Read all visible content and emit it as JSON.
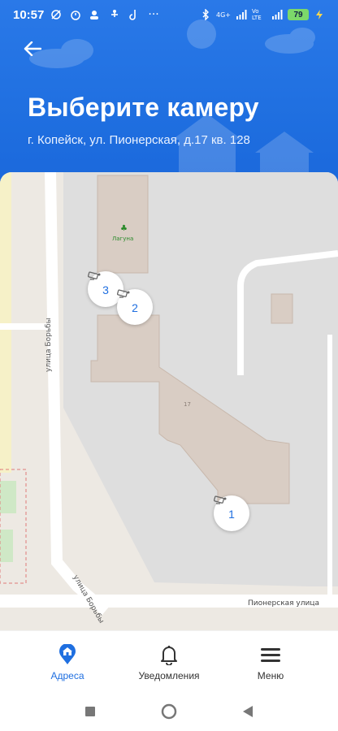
{
  "status_bar": {
    "time": "10:57",
    "network_label": "4G+",
    "wifi_label": "Vo LTE",
    "battery": "79"
  },
  "header": {
    "title": "Выберите камеру",
    "subtitle": "г. Копейск, ул. Пионерская, д.17 кв. 128"
  },
  "map": {
    "poi_label": "Лагуна",
    "building_number": "17",
    "streets": [
      {
        "label": "улица Борьбы"
      },
      {
        "label": "улица Борьбы"
      },
      {
        "label": "Пионерская улица"
      }
    ],
    "cameras": [
      {
        "number": "3"
      },
      {
        "number": "2"
      },
      {
        "number": "1"
      }
    ]
  },
  "bottom_nav": {
    "items": [
      {
        "label": "Адреса",
        "icon": "location-home-icon",
        "active": true
      },
      {
        "label": "Уведомления",
        "icon": "bell-icon",
        "active": false
      },
      {
        "label": "Меню",
        "icon": "menu-icon",
        "active": false
      }
    ]
  },
  "colors": {
    "accent": "#1f6fe0",
    "map_background": "#ede9e3",
    "building": "#d9cdc4"
  }
}
